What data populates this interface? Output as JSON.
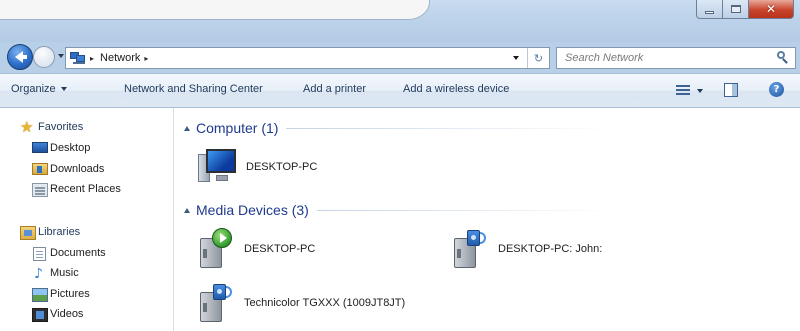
{
  "window": {
    "minimize_icon": "minimize-icon",
    "maximize_icon": "maximize-icon",
    "close_icon": "close-icon",
    "close_glyph": "✕",
    "close_color": "#c9452d"
  },
  "address": {
    "breadcrumb": [
      "Network"
    ],
    "crumb_separator": "▸",
    "location_icon": "network-icon",
    "refresh_glyph": "↻"
  },
  "search": {
    "placeholder": "Search Network"
  },
  "toolbar": {
    "organize": "Organize",
    "network_sharing": "Network and Sharing Center",
    "add_printer": "Add a printer",
    "add_wireless": "Add a wireless device",
    "help_glyph": "?"
  },
  "sidebar": {
    "favorites": {
      "label": "Favorites",
      "items": [
        {
          "label": "Desktop",
          "icon": "desktop-icon"
        },
        {
          "label": "Downloads",
          "icon": "downloads-icon"
        },
        {
          "label": "Recent Places",
          "icon": "recent-places-icon"
        }
      ]
    },
    "libraries": {
      "label": "Libraries",
      "items": [
        {
          "label": "Documents",
          "icon": "documents-icon"
        },
        {
          "label": "Music",
          "icon": "music-icon"
        },
        {
          "label": "Pictures",
          "icon": "pictures-icon"
        },
        {
          "label": "Videos",
          "icon": "videos-icon"
        }
      ]
    }
  },
  "groups": {
    "computer": {
      "label": "Computer (1)",
      "items": [
        {
          "label": "DESKTOP-PC",
          "icon": "computer-icon"
        }
      ]
    },
    "media": {
      "label": "Media Devices (3)",
      "items": [
        {
          "label": "DESKTOP-PC",
          "icon": "media-player-icon"
        },
        {
          "label": "DESKTOP-PC: John:",
          "icon": "media-renderer-icon"
        },
        {
          "label": "Technicolor TGXXX (1009JT8JT)",
          "icon": "media-renderer-icon"
        }
      ]
    }
  },
  "colors": {
    "frame": "#b8cfe8",
    "group_header_text": "#1e3a8c",
    "command_text": "#1e395b"
  }
}
